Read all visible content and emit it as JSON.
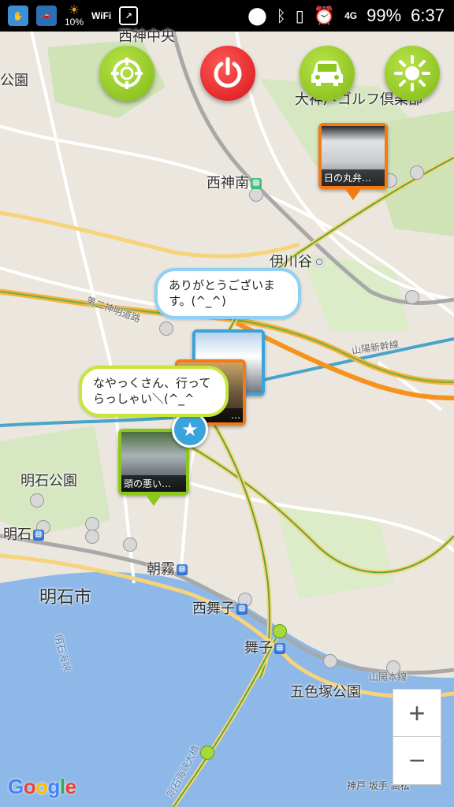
{
  "status_bar": {
    "left_icons": [
      "hand-app-icon",
      "car-app-icon",
      "weather-icon",
      "wifi-icon",
      "share-icon"
    ],
    "weather_percent": "10%",
    "wifi_label": "WiFi",
    "network": "4G",
    "battery": "99%",
    "time": "6:37"
  },
  "top_buttons": [
    {
      "name": "target-button",
      "icon": "crosshair-icon",
      "color": "#8cc71c"
    },
    {
      "name": "power-button",
      "icon": "power-icon",
      "color": "#e21d22"
    },
    {
      "name": "car-button",
      "icon": "car-icon",
      "color": "#8cc71c"
    },
    {
      "name": "brightness-button",
      "icon": "sun-icon",
      "color": "#8cc71c"
    }
  ],
  "map_labels": {
    "nishikami_chuo": "西神中央",
    "ookura_golf": "大神戸ゴルフ倶楽部",
    "park_left": "公園",
    "nishikami_minami": "西神南",
    "ikawadani": "伊川谷",
    "daini_shinmei": "第二神明道路",
    "sanyo_shinkansen": "山陽新幹線",
    "akashi_park": "明石公園",
    "akashi": "明石",
    "asagiri": "朝霧",
    "akashi_city": "明石市",
    "nishimaiko": "西舞子",
    "maiko": "舞子",
    "goshikizuka_park": "五色塚公園",
    "sanyo_honsen": "山陽本線",
    "akashi_kaikyo": "明石海峡",
    "akashi_kaikyo_ohashi": "明石海峡大橋",
    "kobe_sakate": "神戸 坂手 高松"
  },
  "markers": [
    {
      "name": "photo-marker-car",
      "caption": "日の丸弁…",
      "color": "#f47a14"
    },
    {
      "name": "photo-marker-blue",
      "caption": "",
      "color": "#3aa3dc"
    },
    {
      "name": "photo-marker-orange",
      "caption": "…",
      "color": "#f47a14"
    },
    {
      "name": "photo-marker-green",
      "caption": "頭の悪い…",
      "color": "#8cc71c"
    }
  ],
  "bubbles": {
    "thanks": "ありがとうございます。(^_^)",
    "farewell": "なやっくさん、行ってらっしゃい＼(^_^"
  },
  "zoom": {
    "in": "+",
    "out": "−"
  },
  "google_logo": "Google"
}
